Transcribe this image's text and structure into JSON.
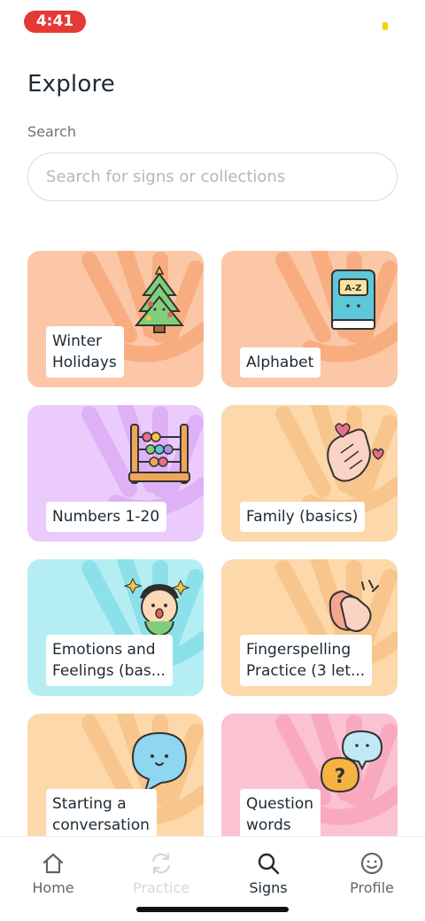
{
  "status": {
    "time": "4:41"
  },
  "header": {
    "title": "Explore"
  },
  "search": {
    "label": "Search",
    "placeholder": "Search for signs or collections",
    "value": ""
  },
  "collections": [
    {
      "label": "Winter\nHolidays",
      "color": "#fbc7a6",
      "accent": "#f8ad80",
      "icon": "christmas-tree-icon"
    },
    {
      "label": "Alphabet",
      "color": "#fbc7a6",
      "accent": "#f8ad80",
      "icon": "book-az-icon"
    },
    {
      "label": "Numbers 1-20",
      "color": "#ebcbfb",
      "accent": "#deb0f6",
      "icon": "abacus-icon"
    },
    {
      "label": "Family (basics)",
      "color": "#fcd8ab",
      "accent": "#f8c58c",
      "icon": "hands-heart-icon"
    },
    {
      "label": "Emotions and\nFeelings (bas...",
      "color": "#b4eef2",
      "accent": "#8ce0ea",
      "icon": "happy-face-icon"
    },
    {
      "label": "Fingerspelling\nPractice (3 let...",
      "color": "#fcd8ab",
      "accent": "#f8c58c",
      "icon": "clapping-hands-icon"
    },
    {
      "label": "Starting a\nconversation",
      "color": "#fcd8ab",
      "accent": "#f8c58c",
      "icon": "speech-bubble-icon"
    },
    {
      "label": "Question\nwords",
      "color": "#fbc2d2",
      "accent": "#f8a9c0",
      "icon": "question-bubble-icon"
    }
  ],
  "tabs": [
    {
      "label": "Home",
      "icon": "home-icon",
      "state": "normal"
    },
    {
      "label": "Practice",
      "icon": "refresh-icon",
      "state": "disabled"
    },
    {
      "label": "Signs",
      "icon": "search-icon",
      "state": "active"
    },
    {
      "label": "Profile",
      "icon": "smiley-icon",
      "state": "normal"
    }
  ]
}
